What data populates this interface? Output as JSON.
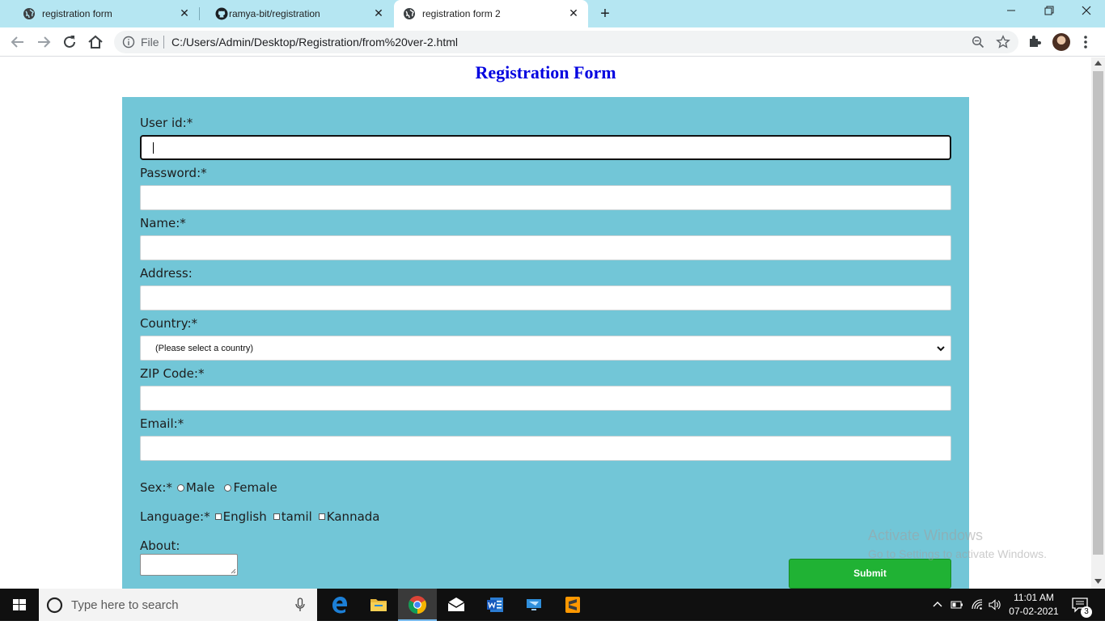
{
  "browser": {
    "tabs": [
      {
        "title": "registration form",
        "icon": "globe-icon",
        "active": false
      },
      {
        "title": "ramya-bit/registration",
        "icon": "github-icon",
        "active": false
      },
      {
        "title": "registration form 2",
        "icon": "globe-icon",
        "active": true
      }
    ],
    "address": {
      "scheme_label": "File",
      "url": "C:/Users/Admin/Desktop/Registration/from%20ver-2.html"
    }
  },
  "page": {
    "title": "Registration Form",
    "title_color": "#0000e0",
    "panel_color": "#72c6d7",
    "form": {
      "user_id": {
        "label": "User id:*",
        "value": ""
      },
      "password": {
        "label": "Password:*",
        "value": ""
      },
      "name": {
        "label": "Name:*",
        "value": ""
      },
      "address": {
        "label": "Address:",
        "value": ""
      },
      "country": {
        "label": "Country:*",
        "selected": "(Please select a country)"
      },
      "zip": {
        "label": "ZIP Code:*",
        "value": ""
      },
      "email": {
        "label": "Email:*",
        "value": ""
      },
      "sex": {
        "label": "Sex:*",
        "options": [
          "Male",
          "Female"
        ]
      },
      "language": {
        "label": "Language:*",
        "options": [
          "English",
          "tamil",
          "Kannada"
        ]
      },
      "about": {
        "label": "About:",
        "value": ""
      },
      "submit_label": "Submit",
      "submit_color": "#20b234"
    },
    "watermark": {
      "title": "Activate Windows",
      "subtitle": "Go to Settings to activate Windows."
    }
  },
  "taskbar": {
    "search_placeholder": "Type here to search",
    "apps": [
      "edge-icon",
      "file-explorer-icon",
      "chrome-icon",
      "mail-icon",
      "word-icon",
      "remote-desktop-icon",
      "sublime-text-icon"
    ],
    "time": "11:01 AM",
    "date": "07-02-2021",
    "notification_count": "3"
  }
}
